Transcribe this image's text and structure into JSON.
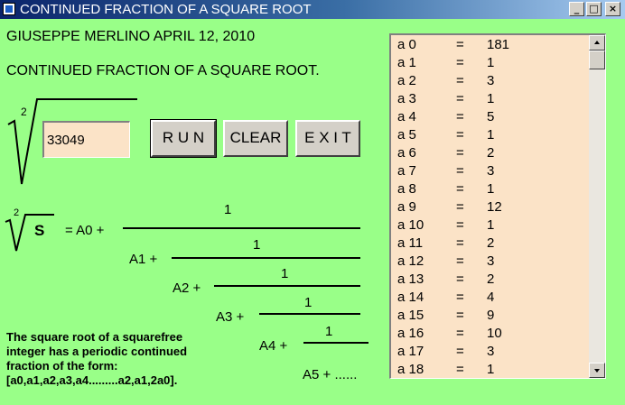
{
  "window": {
    "title": "CONTINUED FRACTION OF A SQUARE ROOT",
    "minimize": "_",
    "maximize": "□",
    "close": "×"
  },
  "header": {
    "author": "GIUSEPPE  MERLINO   APRIL 12, 2010",
    "heading": "CONTINUED FRACTION OF A SQUARE ROOT."
  },
  "input": {
    "root_index": "2",
    "value": "33049"
  },
  "buttons": {
    "run": "R U N",
    "clear": "CLEAR",
    "exit": "E X I T"
  },
  "formula": {
    "root_index": "2",
    "radicand": "S",
    "lhs_eq": "= A0 +",
    "numerators": [
      "1",
      "1",
      "1",
      "1",
      "1"
    ],
    "terms": [
      "A1 +",
      "A2 +",
      "A3 +",
      "A4 +",
      "A5 +"
    ],
    "trailing_dots": "......"
  },
  "note": {
    "lines": [
      "The square root of a squarefree",
      "integer has a periodic continued",
      "fraction of the form:",
      "[a0,a1,a2,a3,a4.........a2,a1,2a0]."
    ]
  },
  "results": {
    "eq_sign": "=",
    "rows": [
      {
        "label": "a 0",
        "value": "181"
      },
      {
        "label": "a 1",
        "value": "1"
      },
      {
        "label": "a 2",
        "value": "3"
      },
      {
        "label": "a 3",
        "value": "1"
      },
      {
        "label": "a 4",
        "value": "5"
      },
      {
        "label": "a 5",
        "value": "1"
      },
      {
        "label": "a 6",
        "value": "2"
      },
      {
        "label": "a 7",
        "value": "3"
      },
      {
        "label": "a 8",
        "value": "1"
      },
      {
        "label": "a 9",
        "value": "12"
      },
      {
        "label": "a 10",
        "value": "1"
      },
      {
        "label": "a 11",
        "value": "2"
      },
      {
        "label": "a 12",
        "value": "3"
      },
      {
        "label": "a 13",
        "value": "2"
      },
      {
        "label": "a 14",
        "value": "4"
      },
      {
        "label": "a 15",
        "value": "9"
      },
      {
        "label": "a 16",
        "value": "10"
      },
      {
        "label": "a 17",
        "value": "3"
      },
      {
        "label": "a 18",
        "value": "1"
      }
    ]
  },
  "colors": {
    "form_background": "#99FF88",
    "field_background": "#FBE3C7",
    "button_face": "#D4D0C8"
  }
}
